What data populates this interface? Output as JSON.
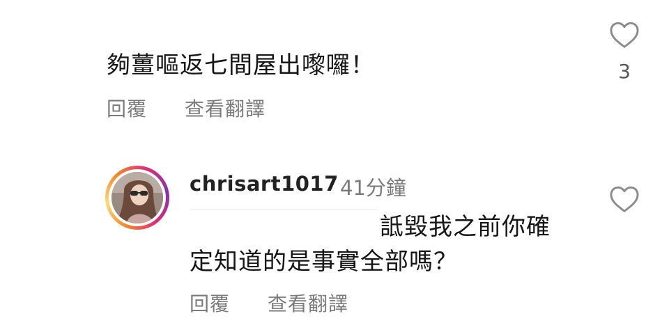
{
  "comments": [
    {
      "text": "夠薑嘔返七間屋出嚟囉！",
      "reply_label": "回覆",
      "translate_label": "查看翻譯",
      "like_count": "3"
    },
    {
      "username": "chrisart1017",
      "timestamp": "41分鐘",
      "text_line1": "詆毀我之前你確",
      "text_line2": "定知道的是事實全部嗎？",
      "reply_label": "回覆",
      "translate_label": "查看翻譯"
    }
  ],
  "icons": {
    "like": "heart-outline-icon"
  },
  "colors": {
    "text": "#161616",
    "secondary_text": "#7a7a7a",
    "heart_stroke": "#8a8a8a"
  }
}
